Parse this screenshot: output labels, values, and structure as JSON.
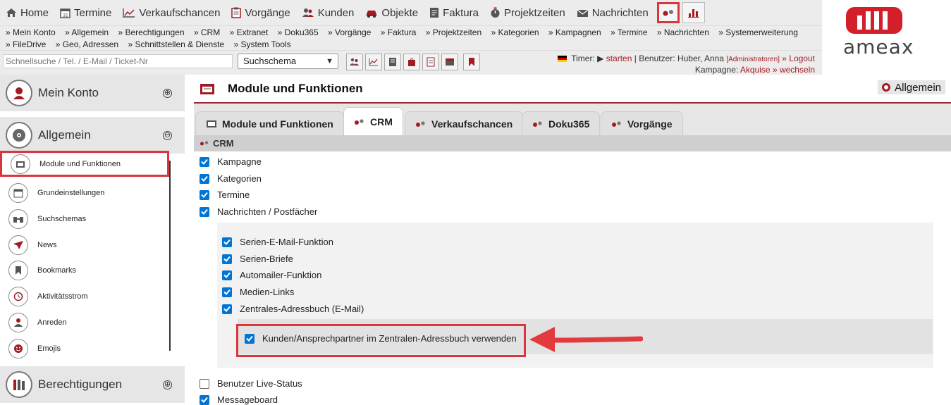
{
  "topnav": {
    "items": [
      {
        "label": "Home",
        "icon": "home-icon"
      },
      {
        "label": "Termine",
        "icon": "calendar-icon"
      },
      {
        "label": "Verkaufschancen",
        "icon": "chart-line-icon"
      },
      {
        "label": "Vorgänge",
        "icon": "clipboard-icon"
      },
      {
        "label": "Kunden",
        "icon": "users-icon"
      },
      {
        "label": "Objekte",
        "icon": "car-icon"
      },
      {
        "label": "Faktura",
        "icon": "invoice-icon"
      },
      {
        "label": "Projektzeiten",
        "icon": "stopwatch-icon"
      },
      {
        "label": "Nachrichten",
        "icon": "envelope-icon"
      }
    ]
  },
  "sublinks": {
    "row1": [
      "» Mein Konto",
      "» Allgemein",
      "» Berechtigungen",
      "» CRM",
      "» Extranet",
      "» Doku365",
      "» Vorgänge",
      "» Faktura",
      "» Projektzeiten",
      "» Kategorien",
      "» Kampagnen",
      "» Termine",
      "» Nachrichten",
      "» Systemerweiterung"
    ],
    "row2": [
      "» FileDrive",
      "» Geo, Adressen",
      "» Schnittstellen & Dienste",
      "» System Tools"
    ]
  },
  "search": {
    "placeholder": "Schnellsuche / Tel. / E-Mail / Ticket-Nr",
    "schema": "Suchschema"
  },
  "status": {
    "timer_label": "Timer:",
    "timer_play": "▶",
    "timer_action": "starten",
    "sep1": "|",
    "user_label": "Benutzer:",
    "user_name": "Huber, Anna",
    "role": "[Administratoren]",
    "logout": "» Logout",
    "campaign_label": "Kampagne:",
    "campaign": "Akquise",
    "change": "» wechseln"
  },
  "logo": {
    "text": "ameax"
  },
  "sidebar": {
    "sections": [
      {
        "label": "Mein Konto",
        "toggle": "⊕"
      },
      {
        "label": "Allgemein",
        "toggle": "⊖"
      },
      {
        "label": "Berechtigungen",
        "toggle": "⊕"
      }
    ],
    "items": [
      {
        "label": "Module und Funktionen"
      },
      {
        "label": "Grundeinstellungen"
      },
      {
        "label": "Suchschemas"
      },
      {
        "label": "News"
      },
      {
        "label": "Bookmarks"
      },
      {
        "label": "Aktivitätsstrom"
      },
      {
        "label": "Anreden"
      },
      {
        "label": "Emojis"
      }
    ]
  },
  "main": {
    "title": "Module und Funktionen",
    "scope": "Allgemein",
    "tabs": [
      "Module und Funktionen",
      "CRM",
      "Verkaufschancen",
      "Doku365",
      "Vorgänge"
    ],
    "section": "CRM",
    "checks": [
      {
        "label": "Kampagne",
        "checked": true
      },
      {
        "label": "Kategorien",
        "checked": true
      },
      {
        "label": "Termine",
        "checked": true
      },
      {
        "label": "Nachrichten / Postfächer",
        "checked": true
      }
    ],
    "sub_checks": [
      {
        "label": "Serien-E-Mail-Funktion",
        "checked": true
      },
      {
        "label": "Serien-Briefe",
        "checked": true
      },
      {
        "label": "Automailer-Funktion",
        "checked": true
      },
      {
        "label": "Medien-Links",
        "checked": true
      },
      {
        "label": "Zentrales-Adressbuch (E-Mail)",
        "checked": true
      }
    ],
    "nested_check": {
      "label": "Kunden/Ansprechpartner im Zentralen-Adressbuch verwenden",
      "checked": true
    },
    "after_checks": [
      {
        "label": "Benutzer Live-Status",
        "checked": false
      },
      {
        "label": "Messageboard",
        "checked": true
      }
    ]
  },
  "colors": {
    "accent": "#d9363e",
    "brand": "#a31b22",
    "checkbox": "#0075d5"
  }
}
